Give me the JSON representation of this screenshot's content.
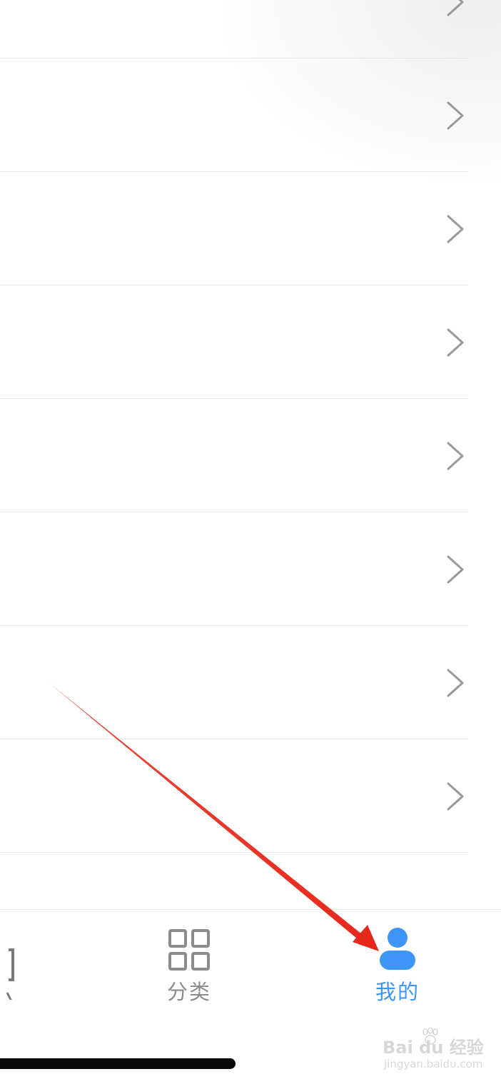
{
  "menu": {
    "row_count": 8
  },
  "tabbar": {
    "tabs": [
      {
        "label": "分类",
        "icon": "grid-icon",
        "active": false
      },
      {
        "label": "我的",
        "icon": "person-icon",
        "active": true
      }
    ]
  },
  "watermark": {
    "brand": "Bai du 经验",
    "url": "jingyan.baidu.com"
  },
  "colors": {
    "active_tab": "#3d96f5",
    "inactive_tab": "#8c8c8c",
    "chevron": "#9a9a9a",
    "divider": "#e8e8e8",
    "annotation_arrow": "#e8271b"
  }
}
